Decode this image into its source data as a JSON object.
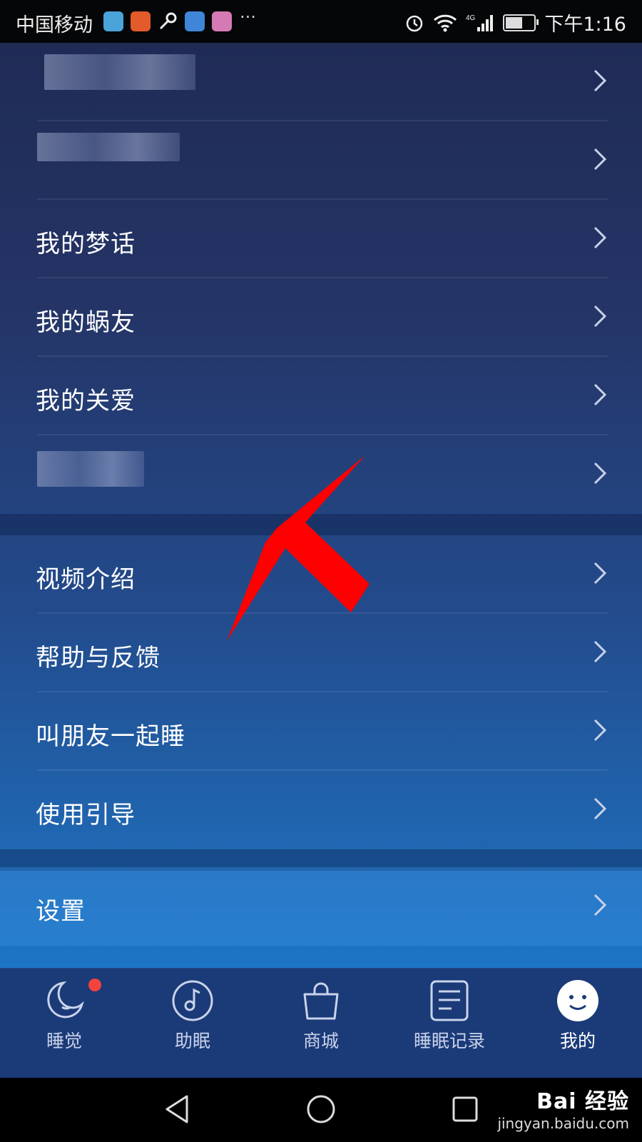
{
  "status_bar": {
    "carrier": "中国移动",
    "more": "···",
    "time": "下午1:16"
  },
  "menu_group_1": [
    {
      "label": ""
    },
    {
      "label": ""
    },
    {
      "label": "我的梦话"
    },
    {
      "label": "我的蜗友"
    },
    {
      "label": "我的关爱"
    },
    {
      "label": ""
    }
  ],
  "menu_group_2": [
    {
      "label": "视频介绍"
    },
    {
      "label": "帮助与反馈"
    },
    {
      "label": "叫朋友一起睡"
    },
    {
      "label": "使用引导"
    }
  ],
  "menu_group_3": [
    {
      "label": "设置"
    }
  ],
  "tabbar": {
    "tabs": [
      {
        "label": "睡觉",
        "icon": "moon-icon",
        "active": false,
        "badge": true
      },
      {
        "label": "助眠",
        "icon": "music-note-icon",
        "active": false
      },
      {
        "label": "商城",
        "icon": "shopping-bag-icon",
        "active": false
      },
      {
        "label": "睡眠记录",
        "icon": "document-icon",
        "active": false
      },
      {
        "label": "我的",
        "icon": "smiley-icon",
        "active": true
      }
    ]
  },
  "watermark": {
    "brand": "Bai 经验",
    "url": "jingyan.baidu.com"
  },
  "colors": {
    "badge": "#f0443d",
    "annotation_arrow": "#ff0000"
  }
}
